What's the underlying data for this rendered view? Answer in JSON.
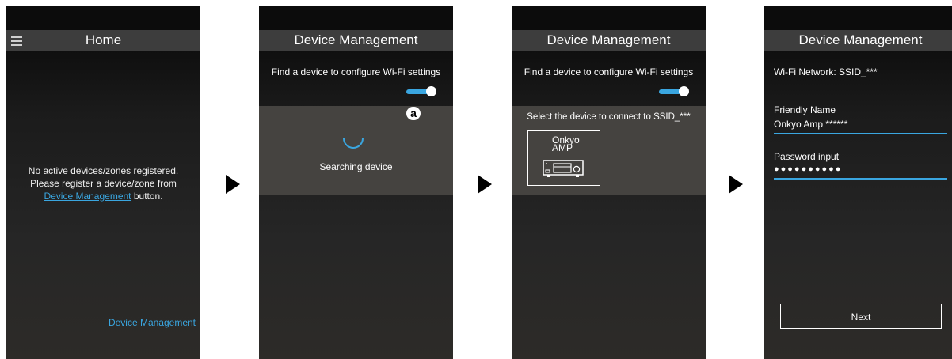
{
  "screen1": {
    "title": "Home",
    "msg_line1": "No active devices/zones registered.",
    "msg_line2": "Please register a device/zone from",
    "msg_link": "Device Management",
    "msg_after_link": " button.",
    "bottom_link": "Device Management"
  },
  "screen2": {
    "title": "Device Management",
    "find_label": "Find a device to configure Wi-Fi settings",
    "badge": "a",
    "searching": "Searching device"
  },
  "screen3": {
    "title": "Device Management",
    "find_label": "Find a device to configure Wi-Fi settings",
    "select_label": "Select the device to connect to SSID_***",
    "device_line1": "Onkyo",
    "device_line2": "AMP"
  },
  "screen4": {
    "title": "Device Management",
    "network_label": "Wi-Fi Network: SSID_***",
    "friendly_label": "Friendly Name",
    "friendly_value": "Onkyo Amp ******",
    "password_label": "Password input",
    "password_value": "●●●●●●●●●●",
    "next_label": "Next"
  },
  "colors": {
    "accent": "#3aa6e0",
    "titlebar": "#3d3d3d",
    "panel": "#454340"
  }
}
